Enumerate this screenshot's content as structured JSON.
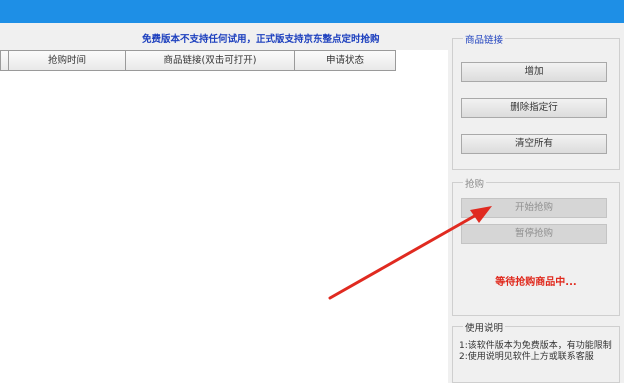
{
  "notice": "免费版本不支持任何试用，正式版支持京东整点定时抢购",
  "table": {
    "columns": [
      "",
      "抢购时间",
      "商品链接(双击可打开)",
      "申请状态"
    ]
  },
  "product_panel": {
    "title": "商品链接",
    "add_label": "增加",
    "delete_label": "删除指定行",
    "clear_label": "清空所有"
  },
  "purchase_panel": {
    "title": "抢购",
    "start_label": "开始抢购",
    "pause_label": "暂停抢购",
    "status": "等待抢购商品中..."
  },
  "instructions": {
    "title": "使用说明",
    "lines": [
      "1:该软件版本为免费版本，有功能限制",
      "2:使用说明见软件上方或联系客服"
    ]
  },
  "colors": {
    "titlebar": "#1e8fe6",
    "notice": "#1c3fbe",
    "status": "#e0291d",
    "arrow": "#e02a20"
  }
}
